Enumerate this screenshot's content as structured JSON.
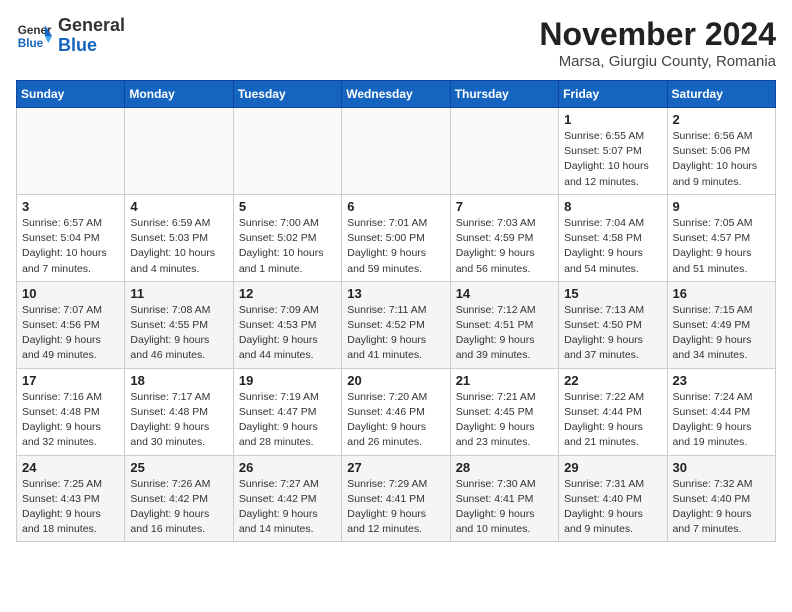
{
  "header": {
    "logo_text_general": "General",
    "logo_text_blue": "Blue",
    "month": "November 2024",
    "location": "Marsa, Giurgiu County, Romania"
  },
  "weekdays": [
    "Sunday",
    "Monday",
    "Tuesday",
    "Wednesday",
    "Thursday",
    "Friday",
    "Saturday"
  ],
  "weeks": [
    [
      {
        "day": "",
        "info": "",
        "empty": true
      },
      {
        "day": "",
        "info": "",
        "empty": true
      },
      {
        "day": "",
        "info": "",
        "empty": true
      },
      {
        "day": "",
        "info": "",
        "empty": true
      },
      {
        "day": "",
        "info": "",
        "empty": true
      },
      {
        "day": "1",
        "info": "Sunrise: 6:55 AM\nSunset: 5:07 PM\nDaylight: 10 hours\nand 12 minutes."
      },
      {
        "day": "2",
        "info": "Sunrise: 6:56 AM\nSunset: 5:06 PM\nDaylight: 10 hours\nand 9 minutes."
      }
    ],
    [
      {
        "day": "3",
        "info": "Sunrise: 6:57 AM\nSunset: 5:04 PM\nDaylight: 10 hours\nand 7 minutes."
      },
      {
        "day": "4",
        "info": "Sunrise: 6:59 AM\nSunset: 5:03 PM\nDaylight: 10 hours\nand 4 minutes."
      },
      {
        "day": "5",
        "info": "Sunrise: 7:00 AM\nSunset: 5:02 PM\nDaylight: 10 hours\nand 1 minute."
      },
      {
        "day": "6",
        "info": "Sunrise: 7:01 AM\nSunset: 5:00 PM\nDaylight: 9 hours\nand 59 minutes."
      },
      {
        "day": "7",
        "info": "Sunrise: 7:03 AM\nSunset: 4:59 PM\nDaylight: 9 hours\nand 56 minutes."
      },
      {
        "day": "8",
        "info": "Sunrise: 7:04 AM\nSunset: 4:58 PM\nDaylight: 9 hours\nand 54 minutes."
      },
      {
        "day": "9",
        "info": "Sunrise: 7:05 AM\nSunset: 4:57 PM\nDaylight: 9 hours\nand 51 minutes."
      }
    ],
    [
      {
        "day": "10",
        "info": "Sunrise: 7:07 AM\nSunset: 4:56 PM\nDaylight: 9 hours\nand 49 minutes.",
        "shaded": true
      },
      {
        "day": "11",
        "info": "Sunrise: 7:08 AM\nSunset: 4:55 PM\nDaylight: 9 hours\nand 46 minutes.",
        "shaded": true
      },
      {
        "day": "12",
        "info": "Sunrise: 7:09 AM\nSunset: 4:53 PM\nDaylight: 9 hours\nand 44 minutes.",
        "shaded": true
      },
      {
        "day": "13",
        "info": "Sunrise: 7:11 AM\nSunset: 4:52 PM\nDaylight: 9 hours\nand 41 minutes.",
        "shaded": true
      },
      {
        "day": "14",
        "info": "Sunrise: 7:12 AM\nSunset: 4:51 PM\nDaylight: 9 hours\nand 39 minutes.",
        "shaded": true
      },
      {
        "day": "15",
        "info": "Sunrise: 7:13 AM\nSunset: 4:50 PM\nDaylight: 9 hours\nand 37 minutes.",
        "shaded": true
      },
      {
        "day": "16",
        "info": "Sunrise: 7:15 AM\nSunset: 4:49 PM\nDaylight: 9 hours\nand 34 minutes.",
        "shaded": true
      }
    ],
    [
      {
        "day": "17",
        "info": "Sunrise: 7:16 AM\nSunset: 4:48 PM\nDaylight: 9 hours\nand 32 minutes."
      },
      {
        "day": "18",
        "info": "Sunrise: 7:17 AM\nSunset: 4:48 PM\nDaylight: 9 hours\nand 30 minutes."
      },
      {
        "day": "19",
        "info": "Sunrise: 7:19 AM\nSunset: 4:47 PM\nDaylight: 9 hours\nand 28 minutes."
      },
      {
        "day": "20",
        "info": "Sunrise: 7:20 AM\nSunset: 4:46 PM\nDaylight: 9 hours\nand 26 minutes."
      },
      {
        "day": "21",
        "info": "Sunrise: 7:21 AM\nSunset: 4:45 PM\nDaylight: 9 hours\nand 23 minutes."
      },
      {
        "day": "22",
        "info": "Sunrise: 7:22 AM\nSunset: 4:44 PM\nDaylight: 9 hours\nand 21 minutes."
      },
      {
        "day": "23",
        "info": "Sunrise: 7:24 AM\nSunset: 4:44 PM\nDaylight: 9 hours\nand 19 minutes."
      }
    ],
    [
      {
        "day": "24",
        "info": "Sunrise: 7:25 AM\nSunset: 4:43 PM\nDaylight: 9 hours\nand 18 minutes.",
        "shaded": true
      },
      {
        "day": "25",
        "info": "Sunrise: 7:26 AM\nSunset: 4:42 PM\nDaylight: 9 hours\nand 16 minutes.",
        "shaded": true
      },
      {
        "day": "26",
        "info": "Sunrise: 7:27 AM\nSunset: 4:42 PM\nDaylight: 9 hours\nand 14 minutes.",
        "shaded": true
      },
      {
        "day": "27",
        "info": "Sunrise: 7:29 AM\nSunset: 4:41 PM\nDaylight: 9 hours\nand 12 minutes.",
        "shaded": true
      },
      {
        "day": "28",
        "info": "Sunrise: 7:30 AM\nSunset: 4:41 PM\nDaylight: 9 hours\nand 10 minutes.",
        "shaded": true
      },
      {
        "day": "29",
        "info": "Sunrise: 7:31 AM\nSunset: 4:40 PM\nDaylight: 9 hours\nand 9 minutes.",
        "shaded": true
      },
      {
        "day": "30",
        "info": "Sunrise: 7:32 AM\nSunset: 4:40 PM\nDaylight: 9 hours\nand 7 minutes.",
        "shaded": true
      }
    ]
  ]
}
